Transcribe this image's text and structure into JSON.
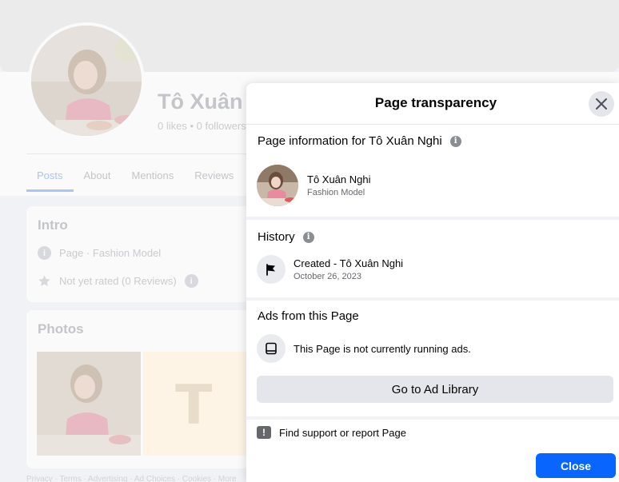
{
  "background": {
    "page_name": "Tô Xuân",
    "stats": "0 likes • 0 followers",
    "tabs": [
      "Posts",
      "About",
      "Mentions",
      "Reviews"
    ],
    "intro": {
      "title": "Intro",
      "category": "Page · Fashion Model",
      "rating": "Not yet rated (0 Reviews)"
    },
    "photos": {
      "title": "Photos",
      "tile_letter": "T"
    },
    "footer": "Privacy · Terms · Advertising · Ad Choices · Cookies · More"
  },
  "dialog": {
    "title": "Page transparency",
    "close_icon": "close-icon",
    "page_info": {
      "heading": "Page information for Tô Xuân Nghi",
      "name": "Tô Xuân Nghi",
      "category": "Fashion Model"
    },
    "history": {
      "heading": "History",
      "event": "Created - Tô Xuân Nghi",
      "date": "October 26, 2023",
      "icon": "flag-icon"
    },
    "ads": {
      "heading": "Ads from this Page",
      "status": "This Page is not currently running ads.",
      "icon": "ad-library-icon",
      "button": "Go to Ad Library"
    },
    "report": {
      "label": "Find support or report Page",
      "icon": "report-icon"
    },
    "close_button": "Close"
  },
  "colors": {
    "primary": "#0866ff",
    "secondary_button": "#e4e6eb",
    "muted_text": "#65676b",
    "separator": "#f0f2f5"
  }
}
